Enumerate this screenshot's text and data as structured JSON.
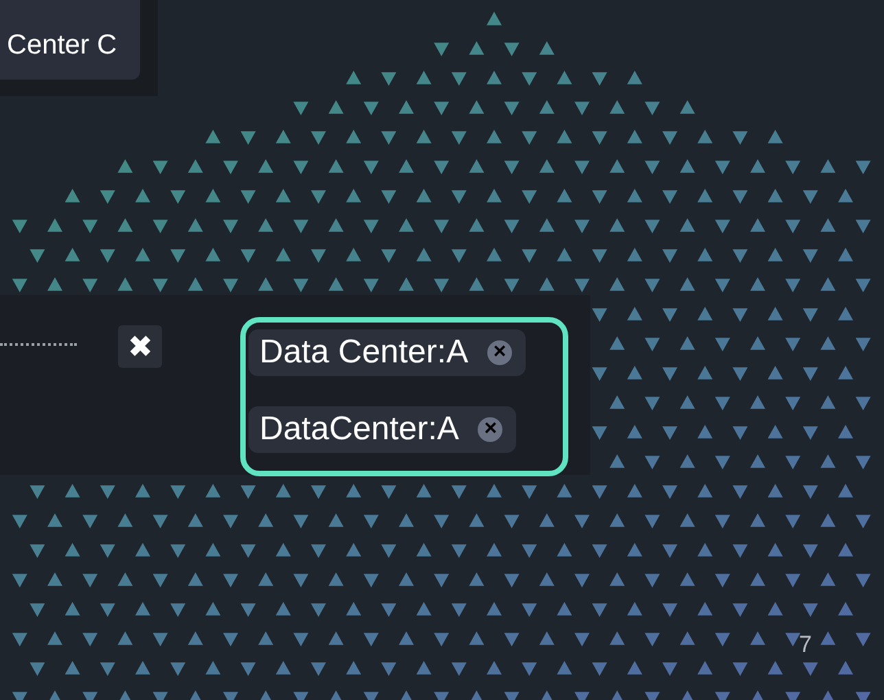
{
  "menu": {
    "items": [
      {
        "label": "Center C"
      }
    ]
  },
  "close_button": {
    "label": "✖"
  },
  "tags": [
    {
      "label": "Data Center:A",
      "remove": "×"
    },
    {
      "label": "DataCenter:A",
      "remove": "×"
    }
  ],
  "page_number": "7"
}
